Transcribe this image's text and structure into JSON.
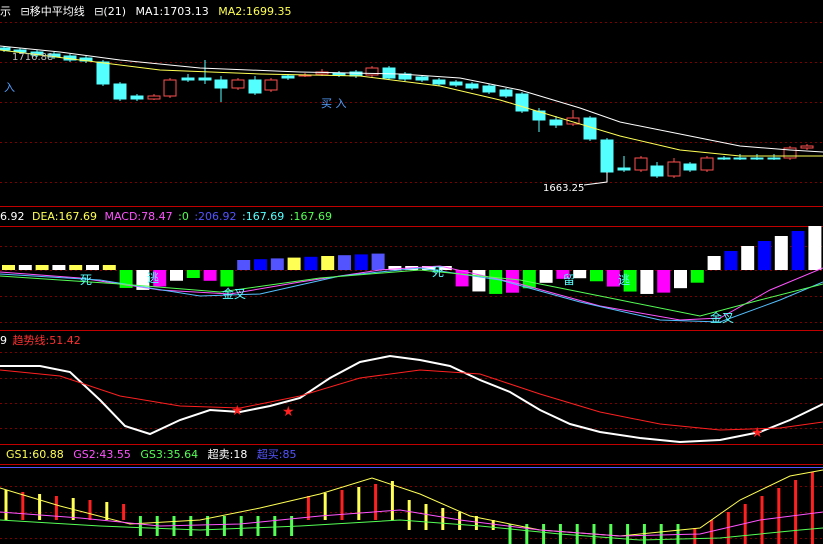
{
  "colors": {
    "background": "#000000",
    "grid": "#5a0000",
    "up_candle": "#ff5050",
    "down_candle": "#54ffff",
    "ma1": "#ffffff",
    "ma2": "#ffff54",
    "dif": "#ff54ff",
    "dea": "#c0c0c0",
    "trend_white": "#ffffff",
    "trend_red": "#ff2020",
    "gs1": "#ffff54",
    "gs2": "#ff54ff",
    "gs3": "#54ff54",
    "buy": "#54a0ff",
    "sep": "#c00000"
  },
  "pane1": {
    "left_glyph": "示",
    "indicator_name": "⊟移中平均线",
    "period": "⊟(21)",
    "ma1_label": "MA1:1703.13",
    "ma2_label": "MA2:1699.35",
    "high_label": "1716.88",
    "low_label": "1663.25",
    "buy_label_1": "买 入",
    "buy_label_left": "入"
  },
  "pane2": {
    "dif_label": "6.92",
    "dea_label": "DEA:167.69",
    "macd_label": "MACD:78.47",
    "zero_label": ":0",
    "v1_label": ":206.92",
    "v2_label": ":167.69",
    "v3_label": ":167.69",
    "cross_labels": [
      "死",
      "金叉",
      "死",
      "金叉"
    ],
    "mark_labels": [
      "逃",
      "留",
      "逃",
      "留",
      "留"
    ]
  },
  "pane3": {
    "lead": "9",
    "trend_label": "趋势线:51.42"
  },
  "pane4": {
    "gs1_label": "GS1:60.88",
    "gs2_label": "GS2:43.55",
    "gs3_label": "GS3:35.64",
    "oversold_label": "超卖:18",
    "overbought_label": "超买:85"
  },
  "chart_data": {
    "type": "candlestick",
    "ma1_last": 1703.13,
    "ma2_last": 1699.35,
    "annotated_high": 1716.88,
    "annotated_low": 1663.25
  }
}
